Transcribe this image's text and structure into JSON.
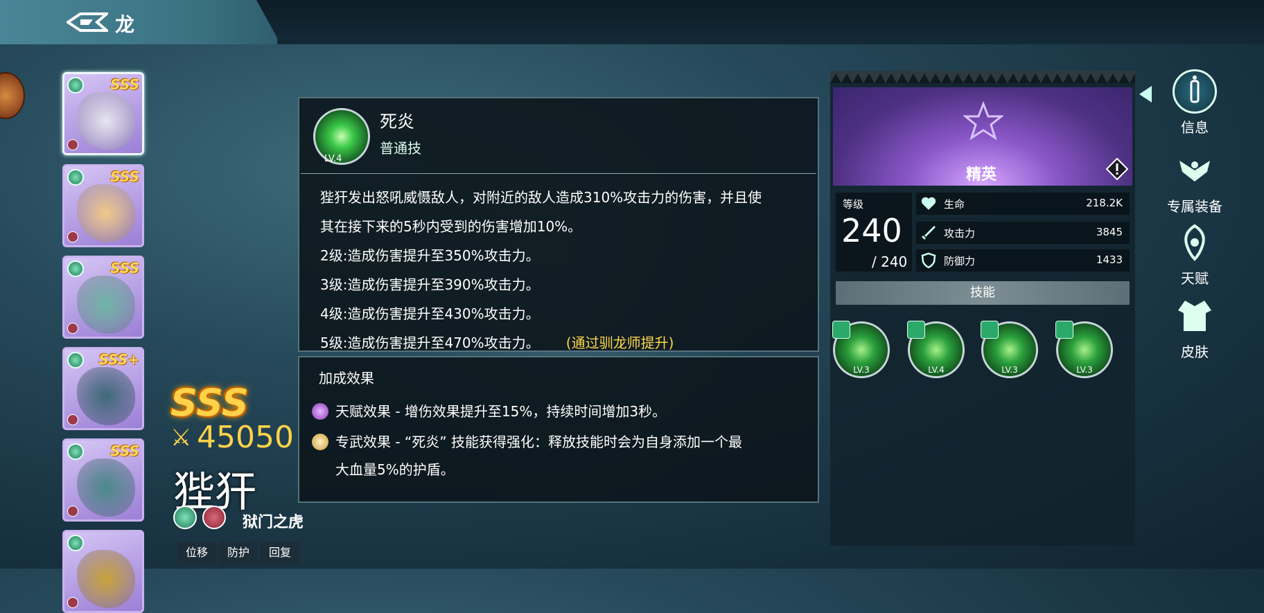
{
  "header": {
    "title": "龙"
  },
  "hero_list": [
    {
      "grade": "SSS",
      "selected": true,
      "art_color": "#e6e6ef"
    },
    {
      "grade": "SSS",
      "selected": false,
      "art_color": "#f2c98a"
    },
    {
      "grade": "SSS",
      "selected": false,
      "art_color": "#6fb5a5"
    },
    {
      "grade": "SSS+",
      "selected": false,
      "art_color": "#3f6a7a"
    },
    {
      "grade": "SSS",
      "selected": false,
      "art_color": "#4a8a8a"
    },
    {
      "grade": "",
      "selected": false,
      "art_color": "#c9a23a"
    }
  ],
  "hero": {
    "grade": "SSS",
    "power": "45050",
    "name": "狴犴",
    "title": "狱门之虎",
    "tags": [
      "位移",
      "防护",
      "回复"
    ]
  },
  "skill": {
    "name": "死炎",
    "type": "普通技",
    "level": "LV.4",
    "desc": [
      "狴犴发出怒吼威慑敌人，对附近的敌人造成310%攻击力的伤害，并且使",
      "其在接下来的5秒内受到的伤害增加10%。",
      "2级:造成伤害提升至350%攻击力。",
      "3级:造成伤害提升至390%攻击力。",
      "4级:造成伤害提升至430%攻击力。",
      "5级:造成伤害提升至470%攻击力。"
    ],
    "lv5_hint": "(通过驯龙师提升)"
  },
  "bonus": {
    "title": "加成效果",
    "talent": "天赋效果 - 增伤效果提升至15%，持续时间增加3秒。",
    "exclusive_line1": "专武效果 - “死炎” 技能获得强化：释放技能时会为自身添加一个最",
    "exclusive_line2": "大血量5%的护盾。"
  },
  "stats": {
    "rank": "精英",
    "level_label": "等级",
    "level": "240",
    "level_max": "/ 240",
    "hp_label": "生命",
    "hp": "218.2K",
    "atk_label": "攻击力",
    "atk": "3845",
    "def_label": "防御力",
    "def": "1433"
  },
  "skills_header": "技能",
  "skill_slots": [
    "LV.3",
    "LV.4",
    "LV.3",
    "LV.3"
  ],
  "nav": [
    {
      "label": "信息",
      "icon": "info-icon"
    },
    {
      "label": "专属装备",
      "icon": "exclusive-gear-icon"
    },
    {
      "label": "天赋",
      "icon": "talent-icon"
    },
    {
      "label": "皮肤",
      "icon": "skin-icon"
    }
  ],
  "colors": {
    "gold": "#ffd24a",
    "panel": "#0c161c",
    "accent_green": "#3cc94a",
    "banner_purple": "#8a57c9"
  }
}
